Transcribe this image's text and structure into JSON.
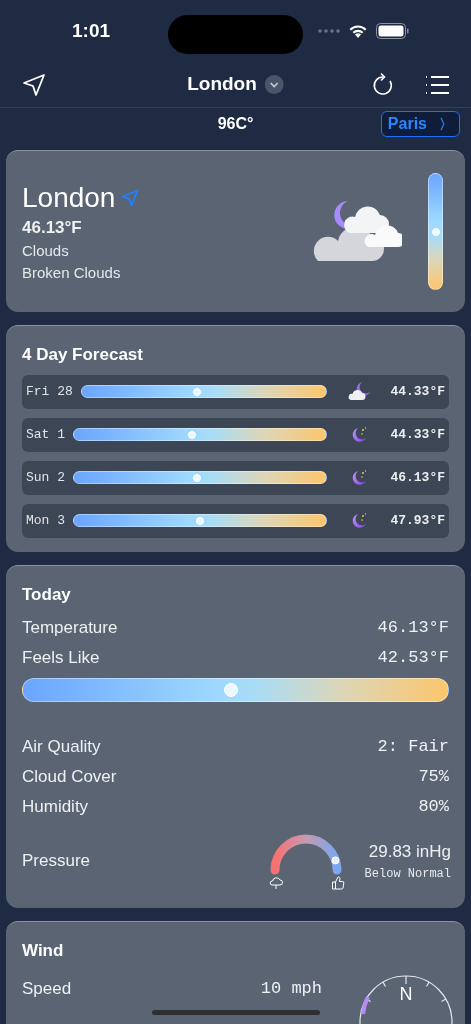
{
  "status_bar": {
    "time": "1:01"
  },
  "nav": {
    "title": "London"
  },
  "sub_bar": {
    "reading": "96C°",
    "next_city": "Paris",
    "next_arrow": "〉"
  },
  "current": {
    "city": "London",
    "temperature": "46.13°F",
    "condition": "Clouds",
    "description": "Broken Clouds",
    "level": 0.5
  },
  "forecast": {
    "title": "4 Day Forecast",
    "days": [
      {
        "day": "Fri 28",
        "level": 0.47,
        "kind": "cloud-moon",
        "temperature": "44.33°F"
      },
      {
        "day": "Sat 1",
        "level": 0.47,
        "kind": "moon",
        "temperature": "44.33°F"
      },
      {
        "day": "Sun 2",
        "level": 0.49,
        "kind": "moon",
        "temperature": "46.13°F"
      },
      {
        "day": "Mon 3",
        "level": 0.5,
        "kind": "moon",
        "temperature": "47.93°F"
      }
    ]
  },
  "today": {
    "title": "Today",
    "top_rows": [
      {
        "label": "Temperature",
        "value": "46.13°F"
      },
      {
        "label": "Feels Like",
        "value": "42.53°F"
      }
    ],
    "level": 0.49,
    "rows": [
      {
        "label": "Air Quality",
        "value": "2: Fair"
      },
      {
        "label": "Cloud Cover",
        "value": "75%"
      },
      {
        "label": "Humidity",
        "value": "80%"
      }
    ],
    "pressure": {
      "label": "Pressure",
      "value": "29.83 inHg",
      "note": "Below Normal",
      "level": 0.9
    }
  },
  "wind": {
    "title": "Wind",
    "rows": [
      {
        "label": "Speed",
        "value": "10 mph"
      }
    ],
    "compass": {
      "north": "N"
    }
  }
}
